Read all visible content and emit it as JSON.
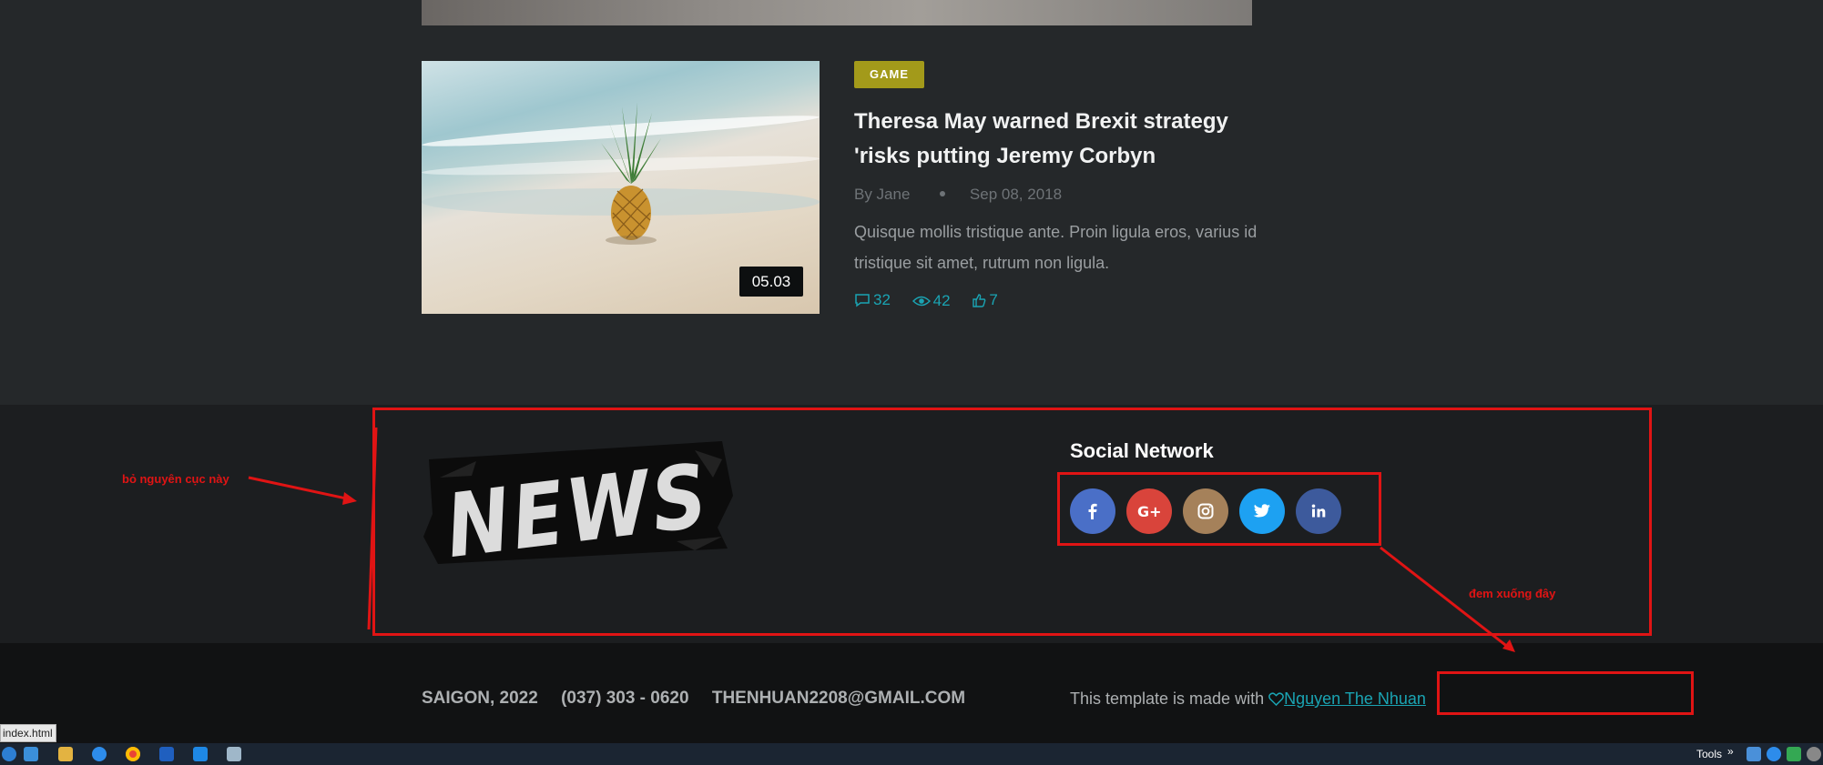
{
  "article": {
    "duration": "05.03",
    "category": "GAME",
    "title": "Theresa May warned Brexit strategy 'risks putting Jeremy Corbyn",
    "author": "By Jane",
    "date": "Sep 08, 2018",
    "excerpt": "Quisque mollis tristique ante. Proin ligula eros, varius id tristique sit amet, rutrum non ligula.",
    "comments": "32",
    "views": "42",
    "likes": "7"
  },
  "footer": {
    "logo_text": "NEWS",
    "social_title": "Social Network",
    "social_icons": [
      "facebook-icon",
      "google-plus-icon",
      "instagram-icon",
      "twitter-icon",
      "linkedin-icon"
    ],
    "social_colors": [
      "#4a6fc7",
      "#d9443b",
      "#a5815a",
      "#1da1f2",
      "#3d5a9c"
    ]
  },
  "bottom_bar": {
    "city": "SAIGON, 2022",
    "phone": "(037) 303 - 0620",
    "email": "THENHUAN2208@GMAIL.COM",
    "credit_text": "This template is made with",
    "credit_author": "Nguyen The Nhuan"
  },
  "annotations": {
    "left_note": "bỏ nguyên cục này",
    "right_note": "đem xuống đây",
    "color": "#e01414"
  },
  "taskbar": {
    "tooltip": "index.html",
    "tools_label": "Tools"
  },
  "colors": {
    "accent": "#1aa4b3",
    "tag": "#a39a1a"
  }
}
